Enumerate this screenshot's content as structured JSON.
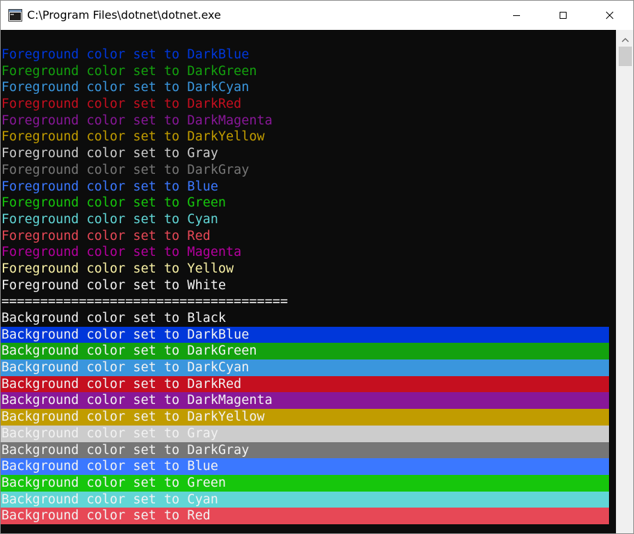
{
  "window": {
    "title": "C:\\Program Files\\dotnet\\dotnet.exe",
    "icons": {
      "app": "console-window-icon",
      "minimize": "minimize-icon",
      "maximize": "maximize-icon",
      "close": "close-icon"
    }
  },
  "console": {
    "background": "#0c0c0c",
    "foreground_lines": [
      {
        "text": "Foreground color set to DarkBlue",
        "fg": "#0037da"
      },
      {
        "text": "Foreground color set to DarkGreen",
        "fg": "#13a10e"
      },
      {
        "text": "Foreground color set to DarkCyan",
        "fg": "#3a96dd"
      },
      {
        "text": "Foreground color set to DarkRed",
        "fg": "#c50f1f"
      },
      {
        "text": "Foreground color set to DarkMagenta",
        "fg": "#881798"
      },
      {
        "text": "Foreground color set to DarkYellow",
        "fg": "#c19c00"
      },
      {
        "text": "Foreground color set to Gray",
        "fg": "#cccccc"
      },
      {
        "text": "Foreground color set to DarkGray",
        "fg": "#767676"
      },
      {
        "text": "Foreground color set to Blue",
        "fg": "#3b78ff"
      },
      {
        "text": "Foreground color set to Green",
        "fg": "#16c60c"
      },
      {
        "text": "Foreground color set to Cyan",
        "fg": "#61d6d6"
      },
      {
        "text": "Foreground color set to Red",
        "fg": "#e74856"
      },
      {
        "text": "Foreground color set to Magenta",
        "fg": "#b4009e"
      },
      {
        "text": "Foreground color set to Yellow",
        "fg": "#f9f1a5"
      },
      {
        "text": "Foreground color set to White",
        "fg": "#f2f2f2"
      }
    ],
    "separator": {
      "text": "=====================================",
      "fg": "#f2f2f2"
    },
    "background_lines": [
      {
        "text": "Background color set to Black",
        "fg": "#f2f2f2",
        "bg": "#0c0c0c"
      },
      {
        "text": "Background color set to DarkBlue",
        "fg": "#f2f2f2",
        "bg": "#0037da"
      },
      {
        "text": "Background color set to DarkGreen",
        "fg": "#f2f2f2",
        "bg": "#13a10e"
      },
      {
        "text": "Background color set to DarkCyan",
        "fg": "#f2f2f2",
        "bg": "#3a96dd"
      },
      {
        "text": "Background color set to DarkRed",
        "fg": "#f2f2f2",
        "bg": "#c50f1f"
      },
      {
        "text": "Background color set to DarkMagenta",
        "fg": "#f2f2f2",
        "bg": "#881798"
      },
      {
        "text": "Background color set to DarkYellow",
        "fg": "#f2f2f2",
        "bg": "#c19c00"
      },
      {
        "text": "Background color set to Gray",
        "fg": "#f2f2f2",
        "bg": "#cccccc"
      },
      {
        "text": "Background color set to DarkGray",
        "fg": "#f2f2f2",
        "bg": "#767676"
      },
      {
        "text": "Background color set to Blue",
        "fg": "#f2f2f2",
        "bg": "#3b78ff"
      },
      {
        "text": "Background color set to Green",
        "fg": "#f2f2f2",
        "bg": "#16c60c"
      },
      {
        "text": "Background color set to Cyan",
        "fg": "#f2f2f2",
        "bg": "#61d6d6"
      },
      {
        "text": "Background color set to Red",
        "fg": "#f2f2f2",
        "bg": "#e74856"
      }
    ]
  },
  "scrollbar": {
    "icons": {
      "up": "scroll-up-arrow-icon"
    }
  }
}
